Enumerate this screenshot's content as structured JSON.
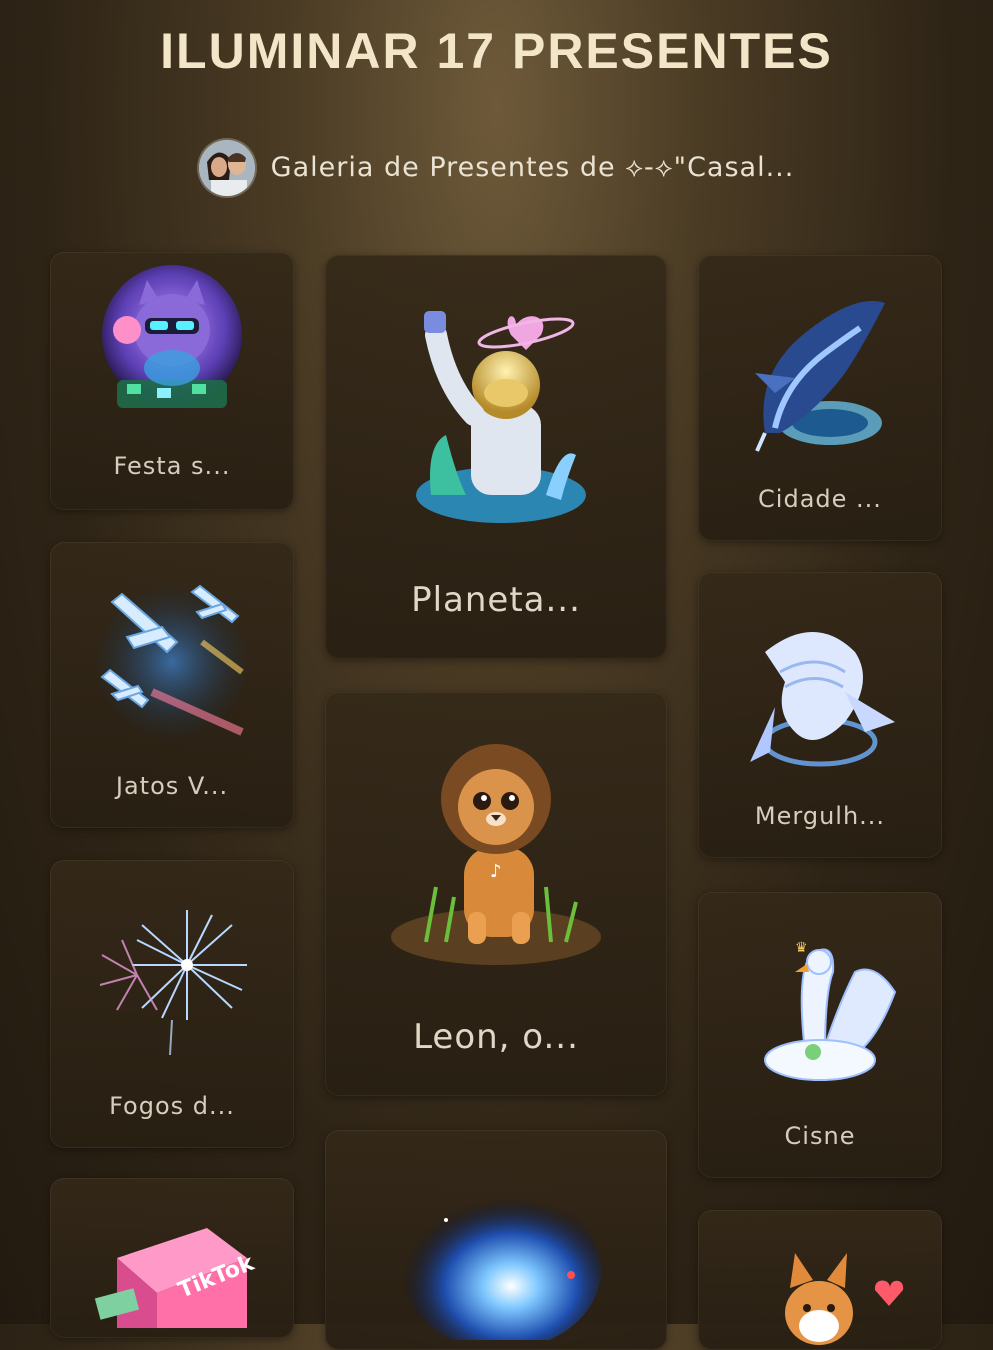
{
  "header": {
    "title": "ILUMINAR 17 PRESENTES",
    "gallery_label": "Galeria de Presentes de ⟡-⟡\"Casal..."
  },
  "gifts": [
    {
      "label": "Festa s..."
    },
    {
      "label": "Planeta..."
    },
    {
      "label": "Cidade ..."
    },
    {
      "label": "Jatos V..."
    },
    {
      "label": "Mergulh..."
    },
    {
      "label": "Leon, o..."
    },
    {
      "label": "Fogos d..."
    },
    {
      "label": "Cisne"
    },
    {
      "label": ""
    },
    {
      "label": ""
    },
    {
      "label": ""
    }
  ]
}
